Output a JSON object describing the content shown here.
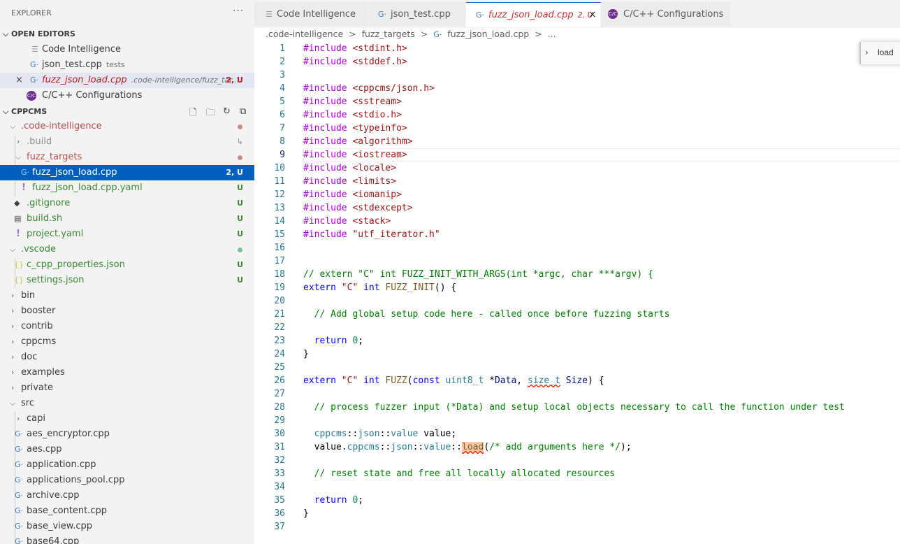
{
  "explorer": {
    "title": "EXPLORER",
    "more": "···",
    "open_editors_label": "OPEN EDITORS",
    "open_editors": [
      {
        "label": "Code Intelligence",
        "desc": "",
        "badge": ""
      },
      {
        "label": "json_test.cpp",
        "desc": "tests",
        "badge": ""
      },
      {
        "label": "fuzz_json_load.cpp",
        "desc": ".code-intelligence/fuzz_tar...",
        "badge": "2, U",
        "close": "×"
      },
      {
        "label": "C/C++ Configurations",
        "desc": "",
        "badge": ""
      }
    ],
    "workspace_label": "CPPCMS",
    "tree": [
      {
        "label": ".code-intelligence",
        "badge": ""
      },
      {
        "label": ".build",
        "badge": "↳"
      },
      {
        "label": "fuzz_targets",
        "badge": ""
      },
      {
        "label": "fuzz_json_load.cpp",
        "badge": "2, U"
      },
      {
        "label": "fuzz_json_load.cpp.yaml",
        "badge": "U"
      },
      {
        "label": ".gitignore",
        "badge": "U"
      },
      {
        "label": "build.sh",
        "badge": "U"
      },
      {
        "label": "project.yaml",
        "badge": "U"
      },
      {
        "label": ".vscode",
        "badge": ""
      },
      {
        "label": "c_cpp_properties.json",
        "badge": "U"
      },
      {
        "label": "settings.json",
        "badge": "U"
      },
      {
        "label": "bin",
        "badge": ""
      },
      {
        "label": "booster",
        "badge": ""
      },
      {
        "label": "contrib",
        "badge": ""
      },
      {
        "label": "cppcms",
        "badge": ""
      },
      {
        "label": "doc",
        "badge": ""
      },
      {
        "label": "examples",
        "badge": ""
      },
      {
        "label": "private",
        "badge": ""
      },
      {
        "label": "src",
        "badge": ""
      },
      {
        "label": "capi",
        "badge": ""
      },
      {
        "label": "aes_encryptor.cpp",
        "badge": ""
      },
      {
        "label": "aes.cpp",
        "badge": ""
      },
      {
        "label": "application.cpp",
        "badge": ""
      },
      {
        "label": "applications_pool.cpp",
        "badge": ""
      },
      {
        "label": "archive.cpp",
        "badge": ""
      },
      {
        "label": "base_content.cpp",
        "badge": ""
      },
      {
        "label": "base_view.cpp",
        "badge": ""
      },
      {
        "label": "base64.cpp",
        "badge": ""
      }
    ]
  },
  "tabs": [
    {
      "label": "Code Intelligence",
      "badge": ""
    },
    {
      "label": "json_test.cpp",
      "badge": ""
    },
    {
      "label": "fuzz_json_load.cpp",
      "badge": "2, U",
      "close": "×"
    },
    {
      "label": "C/C++ Configurations",
      "badge": ""
    }
  ],
  "breadcrumb": [
    ".code-intelligence",
    ">",
    "fuzz_targets",
    ">",
    "fuzz_json_load.cpp",
    ">",
    "..."
  ],
  "find_widget": {
    "value": "load"
  },
  "editor": {
    "current_line": 9,
    "line_numbers": [
      "1",
      "2",
      "3",
      "4",
      "5",
      "6",
      "7",
      "8",
      "9",
      "10",
      "11",
      "12",
      "13",
      "14",
      "15",
      "16",
      "17",
      "18",
      "19",
      "20",
      "21",
      "22",
      "23",
      "24",
      "25",
      "26",
      "27",
      "28",
      "29",
      "30",
      "31",
      "32",
      "33",
      "34",
      "35",
      "36",
      "37"
    ],
    "lines": [
      "#include <stdint.h>",
      "#include <stddef.h>",
      "",
      "#include <cppcms/json.h>",
      "#include <sstream>",
      "#include <stdio.h>",
      "#include <typeinfo>",
      "#include <algorithm>",
      "#include <iostream>",
      "#include <locale>",
      "#include <limits>",
      "#include <iomanip>",
      "#include <stdexcept>",
      "#include <stack>",
      "#include \"utf_iterator.h\"",
      "",
      "",
      "// extern \"C\" int FUZZ_INIT_WITH_ARGS(int *argc, char ***argv) {",
      "extern \"C\" int FUZZ_INIT() {",
      "",
      "  // Add global setup code here - called once before fuzzing starts",
      "",
      "  return 0;",
      "}",
      "",
      "extern \"C\" int FUZZ(const uint8_t *Data, size_t Size) {",
      "",
      "  // process fuzzer input (*Data) and setup local objects necessary to call the function under test",
      "",
      "  cppcms::json::value value;",
      "  value.cppcms::json::value::load(/* add arguments here */);",
      "",
      "  // reset state and free all locally allocated resources",
      "",
      "  return 0;",
      "}",
      ""
    ]
  }
}
